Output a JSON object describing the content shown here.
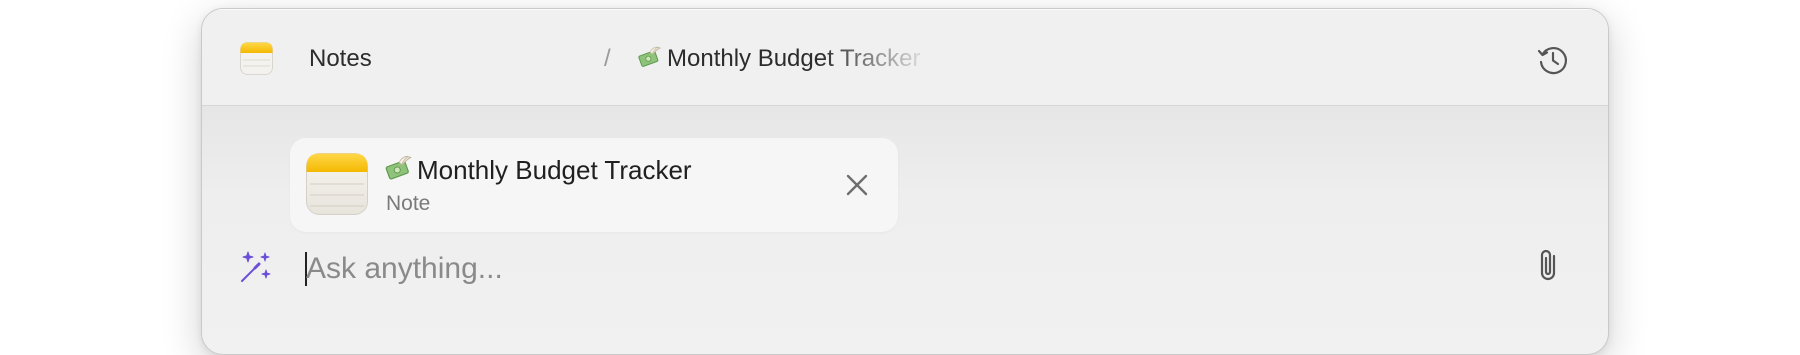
{
  "breadcrumb": {
    "root_label": "Notes",
    "separator": "/",
    "current_emoji": "money-with-wings",
    "current_label": "Monthly Budget Tracker"
  },
  "attachment_chip": {
    "emoji": "money-with-wings",
    "title": "Monthly Budget Tracker",
    "subtitle": "Note"
  },
  "prompt": {
    "placeholder": "Ask anything...",
    "value": ""
  },
  "icons": {
    "app": "notes-app-icon",
    "history": "history-clock-icon",
    "close": "close-icon",
    "ai": "magic-wand-icon",
    "attach": "paperclip-icon"
  },
  "colors": {
    "accent_purple": "#6b4fd8",
    "notes_yellow": "#f7c21a"
  }
}
